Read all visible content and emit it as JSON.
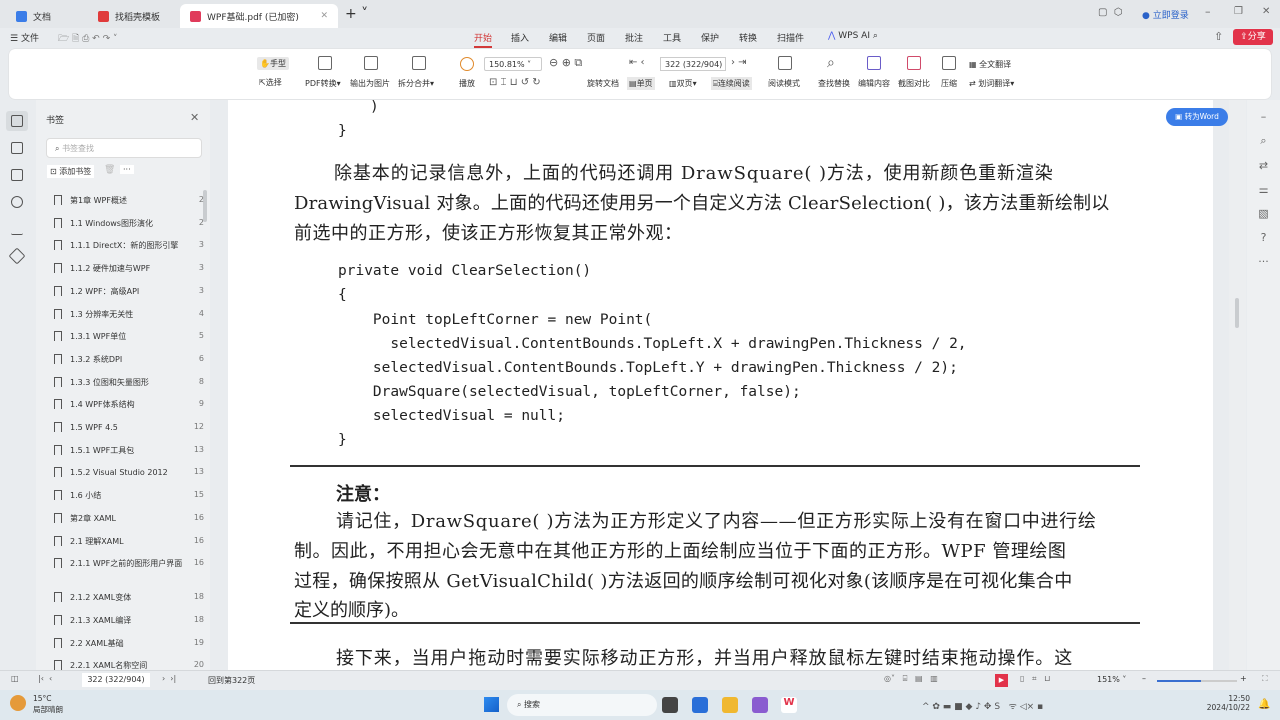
{
  "tabs": [
    {
      "label": "文档",
      "color": "#3b7de8"
    },
    {
      "label": "找稻壳模板",
      "color": "#e03b3b"
    },
    {
      "label": "WPF基础.pdf (已加密)",
      "color": "#e03b5b"
    }
  ],
  "window": {
    "login": "立即登录",
    "share": "分享"
  },
  "menu": {
    "file": "文件",
    "items": [
      "开始",
      "插入",
      "编辑",
      "页面",
      "批注",
      "工具",
      "保护",
      "转换",
      "扫描件"
    ],
    "ai": "WPS AI"
  },
  "ribbon": {
    "hand": "手型",
    "select": "选择",
    "pdf_convert": "PDF转换",
    "export_image": "输出为图片",
    "split_merge": "拆分合并",
    "play": "播放",
    "zoom": "150.81%",
    "rotate": "旋转文档",
    "single": "单页",
    "double": "双页",
    "continuous": "连续阅读",
    "read_mode": "阅读模式",
    "page_box": "322 (322/904)",
    "find_replace": "查找替换",
    "edit_content": "编辑内容",
    "screenshot_compare": "截图对比",
    "compress": "压缩",
    "full_translate": "全文翻译",
    "word_translate": "划词翻译"
  },
  "panel": {
    "title": "书签",
    "search_placeholder": "书签查找",
    "add": "添加书签",
    "more": "···",
    "items": [
      {
        "label": "第1章 WPF概述",
        "page": "2"
      },
      {
        "label": "1.1 Windows图形演化",
        "page": "2"
      },
      {
        "label": "1.1.1 DirectX：新的图形引擎",
        "page": "3"
      },
      {
        "label": "1.1.2 硬件加速与WPF",
        "page": "3"
      },
      {
        "label": "1.2 WPF：高级API",
        "page": "3"
      },
      {
        "label": "1.3 分辨率无关性",
        "page": "4"
      },
      {
        "label": "1.3.1 WPF单位",
        "page": "5"
      },
      {
        "label": "1.3.2 系统DPI",
        "page": "6"
      },
      {
        "label": "1.3.3 位图和矢量图形",
        "page": "8"
      },
      {
        "label": "1.4 WPF体系结构",
        "page": "9"
      },
      {
        "label": "1.5 WPF 4.5",
        "page": "12"
      },
      {
        "label": "1.5.1 WPF工具包",
        "page": "13"
      },
      {
        "label": "1.5.2 Visual Studio 2012",
        "page": "13"
      },
      {
        "label": "1.6 小结",
        "page": "15"
      },
      {
        "label": "第2章 XAML",
        "page": "16"
      },
      {
        "label": "2.1 理解XAML",
        "page": "16"
      },
      {
        "label": "2.1.1 WPF之前的图形用户界面",
        "page": "16"
      },
      {
        "label": "2.1.2 XAML变体",
        "page": "18"
      },
      {
        "label": "2.1.3 XAML编译",
        "page": "18"
      },
      {
        "label": "2.2 XAML基础",
        "page": "19"
      },
      {
        "label": "2.2.1 XAML名称空间",
        "page": "20"
      }
    ]
  },
  "to_word": "转为Word",
  "doc": {
    "brace1": ")",
    "brace2": "}",
    "p1": [
      "除基本的记录信息外，上面的代码还调用 DrawSquare( )方法，使用新颜色重新渲染",
      "DrawingVisual 对象。上面的代码还使用另一个自定义方法 ClearSelection( )，该方法重新绘制以",
      "前选中的正方形，使该正方形恢复其正常外观："
    ],
    "code": [
      "private void ClearSelection()",
      "{",
      "    Point topLeftCorner = new Point(",
      "      selectedVisual.ContentBounds.TopLeft.X + drawingPen.Thickness / 2,",
      "    selectedVisual.ContentBounds.TopLeft.Y + drawingPen.Thickness / 2);",
      "    DrawSquare(selectedVisual, topLeftCorner, false);",
      "    selectedVisual = null;",
      "}"
    ],
    "note_title": "注意：",
    "note": [
      "请记住，DrawSquare( )方法为正方形定义了内容——但正方形实际上没有在窗口中进行绘",
      "制。因此，不用担心会无意中在其他正方形的上面绘制应当位于下面的正方形。WPF 管理绘图",
      "过程，确保按照从 GetVisualChild( )方法返回的顺序绘制可视化对象(该顺序是在可视化集合中",
      "定义的顺序)。"
    ],
    "p2": "接下来，当用户拖动时需要实际移动正方形，并当用户释放鼠标左键时结束拖动操作。这"
  },
  "status": {
    "page": "322 (322/904)",
    "back": "回到第322页",
    "zoom": "151%"
  },
  "taskbar": {
    "temp": "15°C",
    "weather": "局部晴朗",
    "search": "搜索",
    "time": "12:50",
    "date": "2024/10/22"
  }
}
